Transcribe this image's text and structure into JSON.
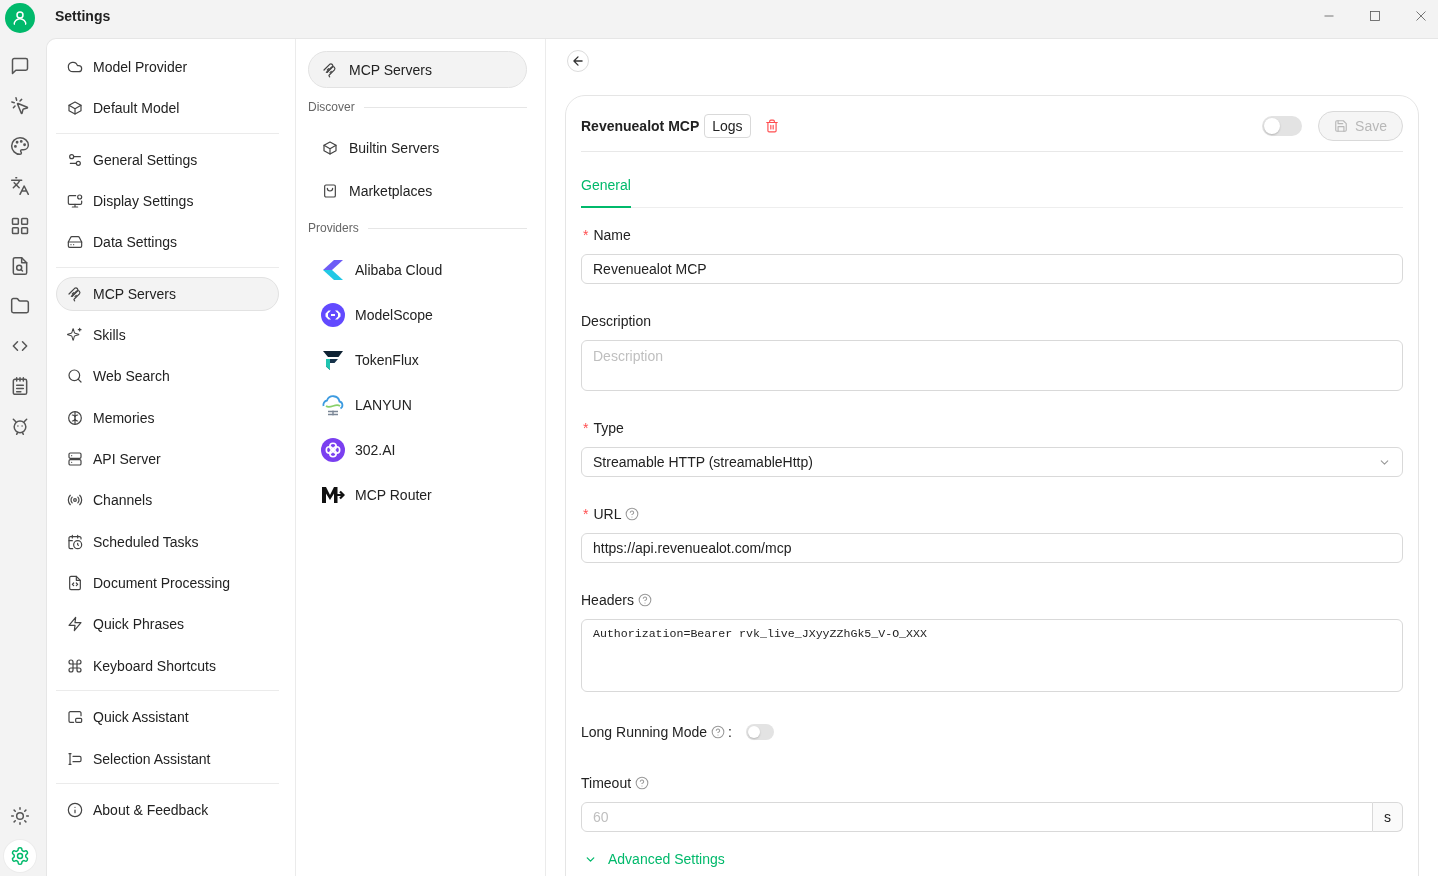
{
  "window": {
    "title": "Settings"
  },
  "rail": {
    "items": [
      {
        "selected": false
      },
      {
        "selected": false
      },
      {
        "selected": false
      },
      {
        "selected": false
      },
      {
        "selected": false
      },
      {
        "selected": false
      },
      {
        "selected": false
      },
      {
        "selected": false
      },
      {
        "selected": false
      },
      {
        "selected": false
      }
    ],
    "bottom_items": [
      {
        "selected": false
      },
      {
        "selected": true
      }
    ]
  },
  "sidebar": {
    "groups": [
      {
        "items": [
          {
            "label": "Model Provider",
            "selected": false
          },
          {
            "label": "Default Model",
            "selected": false
          }
        ]
      },
      {
        "items": [
          {
            "label": "General Settings",
            "selected": false
          },
          {
            "label": "Display Settings",
            "selected": false
          },
          {
            "label": "Data Settings",
            "selected": false
          }
        ]
      },
      {
        "items": [
          {
            "label": "MCP Servers",
            "selected": true
          },
          {
            "label": "Skills",
            "selected": false
          },
          {
            "label": "Web Search",
            "selected": false
          },
          {
            "label": "Memories",
            "selected": false
          },
          {
            "label": "API Server",
            "selected": false
          },
          {
            "label": "Channels",
            "selected": false
          },
          {
            "label": "Scheduled Tasks",
            "selected": false
          },
          {
            "label": "Document Processing",
            "selected": false
          },
          {
            "label": "Quick Phrases",
            "selected": false
          },
          {
            "label": "Keyboard Shortcuts",
            "selected": false
          }
        ]
      },
      {
        "items": [
          {
            "label": "Quick Assistant",
            "selected": false
          },
          {
            "label": "Selection Assistant",
            "selected": false
          }
        ]
      },
      {
        "items": [
          {
            "label": "About & Feedback",
            "selected": false
          }
        ]
      }
    ]
  },
  "mcp_nav": {
    "items": [
      {
        "label": "MCP Servers",
        "selected": true
      }
    ],
    "sections": [
      {
        "title": "Discover",
        "items": [
          {
            "label": "Builtin Servers",
            "selected": false
          },
          {
            "label": "Marketplaces",
            "selected": false
          }
        ]
      },
      {
        "title": "Providers",
        "items": [
          {
            "label": "Alibaba Cloud",
            "selected": false
          },
          {
            "label": "ModelScope",
            "selected": false
          },
          {
            "label": "TokenFlux",
            "selected": false
          },
          {
            "label": "LANYUN",
            "selected": false
          },
          {
            "label": "302.AI",
            "selected": false
          },
          {
            "label": "MCP Router",
            "selected": false
          }
        ]
      }
    ]
  },
  "detail": {
    "title": "Revenuealot MCP",
    "logs_button": "Logs",
    "enabled": false,
    "save_button": {
      "label": "Save",
      "disabled": true
    },
    "tabs": [
      {
        "label": "General",
        "selected": true
      }
    ],
    "fields": [
      {
        "kind": "input",
        "required_mark": "*",
        "label": "Name",
        "help": false,
        "value": "Revenuealot MCP"
      },
      {
        "kind": "textarea",
        "label": "Description",
        "help": false,
        "placeholder": "Description"
      },
      {
        "kind": "select",
        "required_mark": "*",
        "label": "Type",
        "help": false,
        "value": "Streamable HTTP (streamableHttp)"
      },
      {
        "kind": "input",
        "required_mark": "*",
        "label": "URL",
        "help": true,
        "value": "https://api.revenuealot.com/mcp"
      },
      {
        "kind": "code",
        "label": "Headers",
        "help": true,
        "value": "Authorization=Bearer rvk_live_JXyyZZhGk5_V-O_XXX"
      },
      {
        "kind": "switch",
        "label": "Long Running Mode",
        "help": true,
        "label_suffix": ":",
        "on": false
      },
      {
        "kind": "addon",
        "label": "Timeout",
        "help": true,
        "placeholder": "60",
        "suffix": "s"
      }
    ],
    "advanced": {
      "label": "Advanced Settings"
    }
  }
}
